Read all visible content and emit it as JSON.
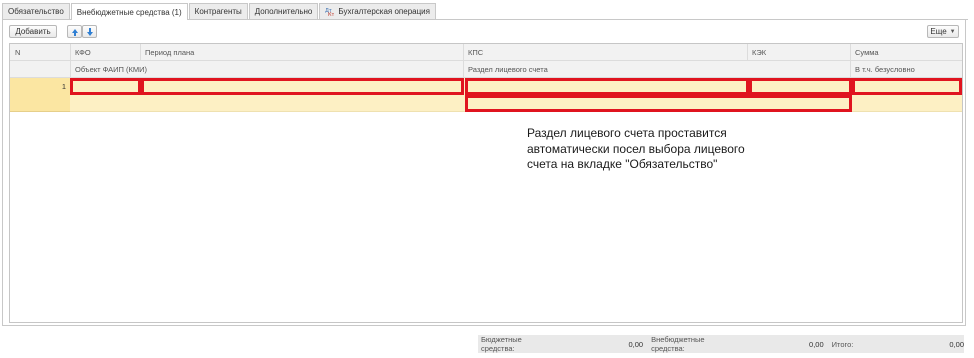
{
  "tabs": [
    {
      "label": "Обязательство"
    },
    {
      "label": "Внебюджетные средства (1)"
    },
    {
      "label": "Контрагенты"
    },
    {
      "label": "Дополнительно"
    },
    {
      "label": "Бухгалтерская операция"
    }
  ],
  "toolbar": {
    "add_label": "Добавить",
    "more_label": "Еще"
  },
  "table": {
    "header_row1": {
      "n": "N",
      "kfo": "КФО",
      "period": "Период плана",
      "kps": "КПС",
      "kek": "КЭК",
      "sum": "Сумма"
    },
    "header_row2": {
      "object": "Объект ФАИП (КМИ)",
      "account_section": "Раздел лицевого счета",
      "including": "В т.ч. безусловно"
    },
    "rows": [
      {
        "n": "1"
      }
    ]
  },
  "annotation": {
    "line1": "Раздел лицевого счета проставится",
    "line2": "автоматически посел выбора лицевого",
    "line3": "счета на вкладке \"Обязательство\"",
    "highlight_color": "#e0141f"
  },
  "footer": {
    "budget_label": "Бюджетные средства:",
    "budget_value": "0,00",
    "extrabudget_label": "Внебюджетные средства:",
    "extrabudget_value": "0,00",
    "total_label": "Итого:",
    "total_value": "0,00"
  },
  "colors": {
    "selected_row": "#fdf0c4",
    "accent_blue": "#2f7fd3"
  }
}
